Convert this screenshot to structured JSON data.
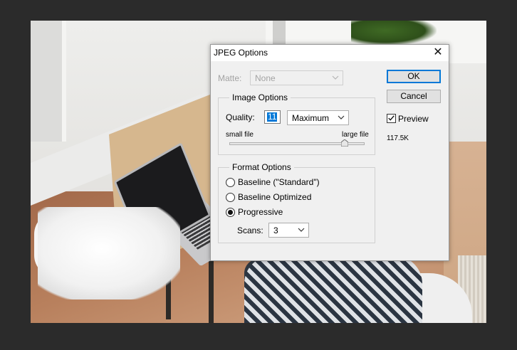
{
  "dialog": {
    "title": "JPEG Options",
    "close_glyph": "✕",
    "matte_label": "Matte:",
    "matte_value": "None",
    "image_options": {
      "title": "Image Options",
      "quality_label": "Quality:",
      "quality_value": "11",
      "quality_preset": "Maximum",
      "small_file_label": "small file",
      "large_file_label": "large file",
      "slider_position": 0.85
    },
    "format_options": {
      "title": "Format Options",
      "baseline_standard": "Baseline (\"Standard\")",
      "baseline_optimized": "Baseline Optimized",
      "progressive": "Progressive",
      "selected": "progressive",
      "scans_label": "Scans:",
      "scans_value": "3"
    },
    "ok_label": "OK",
    "cancel_label": "Cancel",
    "preview_label": "Preview",
    "preview_checked": true,
    "file_size": "117.5K"
  },
  "colors": {
    "app_background": "#2b2b2b",
    "dialog_background": "#f0f0f0",
    "accent": "#0078d7"
  }
}
